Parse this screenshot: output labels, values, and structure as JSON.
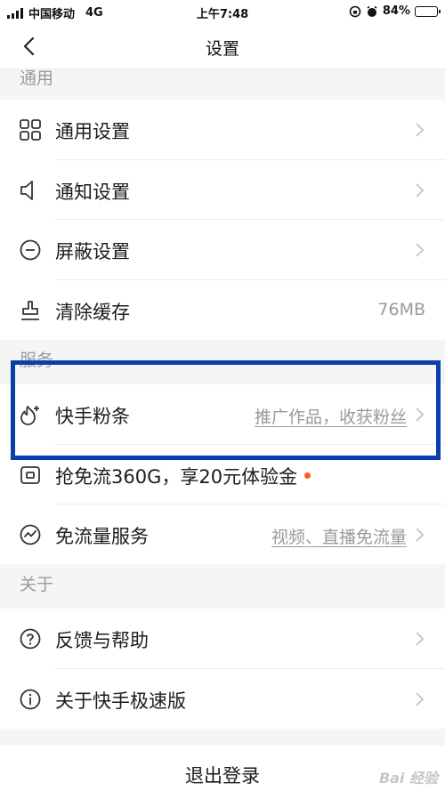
{
  "status_bar": {
    "carrier": "中国移动",
    "network": "4G",
    "time": "上午7:48",
    "battery": "84%",
    "battery_level": 0.84
  },
  "nav": {
    "title": "设置"
  },
  "sections": {
    "general": {
      "header": "通用",
      "items": [
        {
          "label": "通用设置",
          "icon": "grid-icon"
        },
        {
          "label": "通知设置",
          "icon": "speaker-icon"
        },
        {
          "label": "屏蔽设置",
          "icon": "minus-circle-icon"
        },
        {
          "label": "清除缓存",
          "icon": "broom-icon",
          "value": "76MB"
        }
      ]
    },
    "services": {
      "header": "服务",
      "items": [
        {
          "label": "快手粉条",
          "icon": "flame-plus-icon",
          "value": "推广作品，收获粉丝"
        },
        {
          "label": "抢免流360G，享20元体验金",
          "icon": "sim-card-icon",
          "dot_color": "#ff5a1f"
        },
        {
          "label": "免流量服务",
          "icon": "wave-circle-icon",
          "value": "视频、直播免流量"
        }
      ]
    },
    "about": {
      "header": "关于",
      "items": [
        {
          "label": "反馈与帮助",
          "icon": "question-circle-icon"
        },
        {
          "label": "关于快手极速版",
          "icon": "info-circle-icon"
        }
      ]
    }
  },
  "logout_label": "退出登录",
  "watermark": "Bai 经验",
  "colors": {
    "highlight_border": "#0b3ea8",
    "accent_dot": "#ff5a1f"
  }
}
